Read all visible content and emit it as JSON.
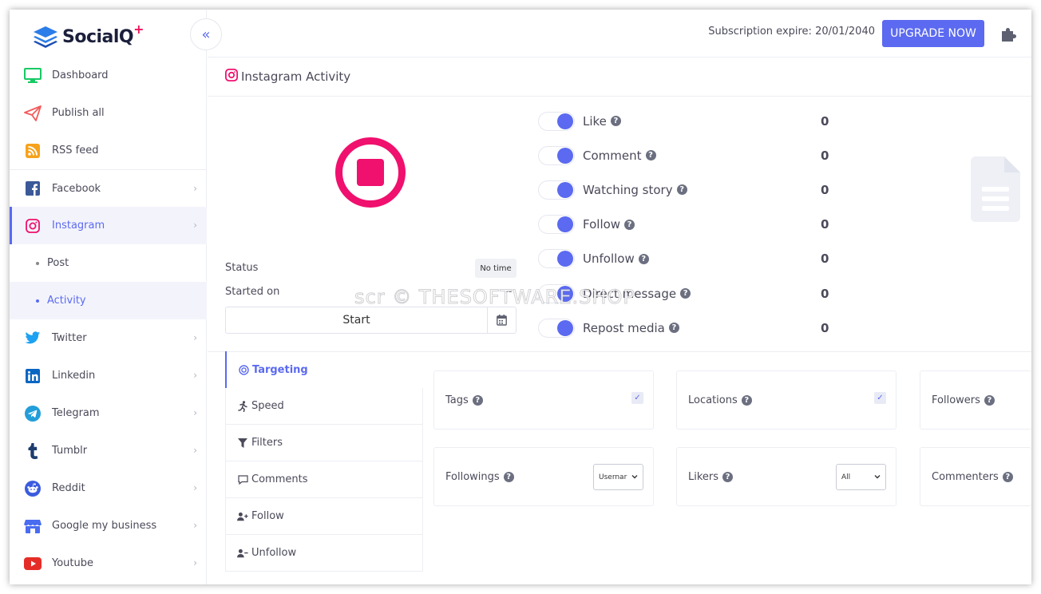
{
  "brand": {
    "name": "SocialQ",
    "plus": "+"
  },
  "header": {
    "subscription": "Subscription expire: 20/01/2040",
    "upgrade_label": "UPGRADE NOW"
  },
  "sidebar": {
    "items": [
      {
        "label": "Dashboard"
      },
      {
        "label": "Publish all"
      },
      {
        "label": "RSS feed"
      },
      {
        "label": "Facebook"
      },
      {
        "label": "Instagram"
      },
      {
        "label": "Post"
      },
      {
        "label": "Activity"
      },
      {
        "label": "Twitter"
      },
      {
        "label": "Linkedin"
      },
      {
        "label": "Telegram"
      },
      {
        "label": "Tumblr"
      },
      {
        "label": "Reddit"
      },
      {
        "label": "Google my business"
      },
      {
        "label": "Youtube"
      }
    ]
  },
  "page": {
    "title": "Instagram Activity"
  },
  "status": {
    "label": "Status",
    "value": "No time",
    "started_label": "Started on",
    "started_value": "--",
    "start_label": "Start"
  },
  "activities": [
    {
      "label": "Like",
      "count": "0"
    },
    {
      "label": "Comment",
      "count": "0"
    },
    {
      "label": "Watching story",
      "count": "0"
    },
    {
      "label": "Follow",
      "count": "0"
    },
    {
      "label": "Unfollow",
      "count": "0"
    },
    {
      "label": "Direct message",
      "count": "0"
    },
    {
      "label": "Repost media",
      "count": "0"
    }
  ],
  "watermark": "scr © THESOFTWARE.SHOP",
  "tabs": [
    {
      "label": "Targeting"
    },
    {
      "label": "Speed"
    },
    {
      "label": "Filters"
    },
    {
      "label": "Comments"
    },
    {
      "label": "Follow"
    },
    {
      "label": "Unfollow"
    }
  ],
  "cards": {
    "tags": {
      "label": "Tags"
    },
    "locations": {
      "label": "Locations"
    },
    "followers": {
      "label": "Followers"
    },
    "followings": {
      "label": "Followings",
      "select_value": "Usernar"
    },
    "likers": {
      "label": "Likers",
      "select_value": "All"
    },
    "commenters": {
      "label": "Commenters"
    }
  },
  "colors": {
    "accent": "#5b6af0",
    "instagram": "#f0106e"
  }
}
